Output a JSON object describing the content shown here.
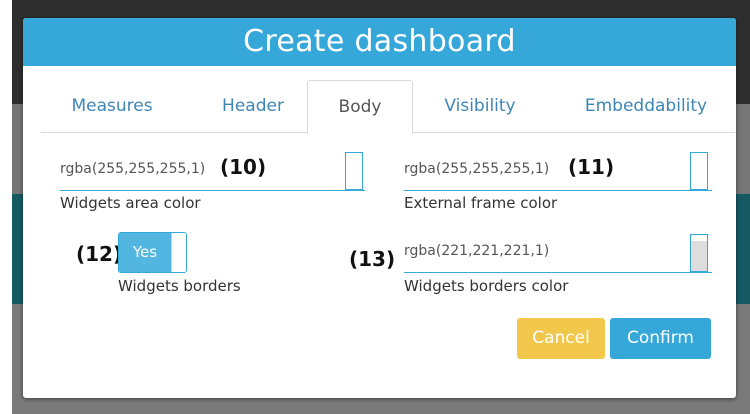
{
  "modal": {
    "title": "Create dashboard"
  },
  "tabs": [
    {
      "label": "Measures"
    },
    {
      "label": "Header"
    },
    {
      "label": "Body",
      "active": true
    },
    {
      "label": "Visibility"
    },
    {
      "label": "Embeddability"
    }
  ],
  "fields": {
    "widgets_area_color": {
      "value": "rgba(255,255,255,1)",
      "label": "Widgets area color",
      "annotation": "(10)",
      "swatch_color": "#ffffff"
    },
    "external_frame_color": {
      "value": "rgba(255,255,255,1)",
      "label": "External frame color",
      "annotation": "(11)",
      "swatch_color": "#ffffff"
    },
    "widgets_borders": {
      "toggle_label": "Yes",
      "toggle_on": true,
      "label": "Widgets borders",
      "annotation": "(12)"
    },
    "widgets_borders_color": {
      "value": "rgba(221,221,221,1)",
      "label": "Widgets borders color",
      "annotation": "(13)",
      "swatch_color": "#dddddd"
    }
  },
  "buttons": {
    "cancel": "Cancel",
    "confirm": "Confirm"
  },
  "colors": {
    "accent": "#35a7d9",
    "cancel": "#f1c84b",
    "text": "#555555"
  }
}
